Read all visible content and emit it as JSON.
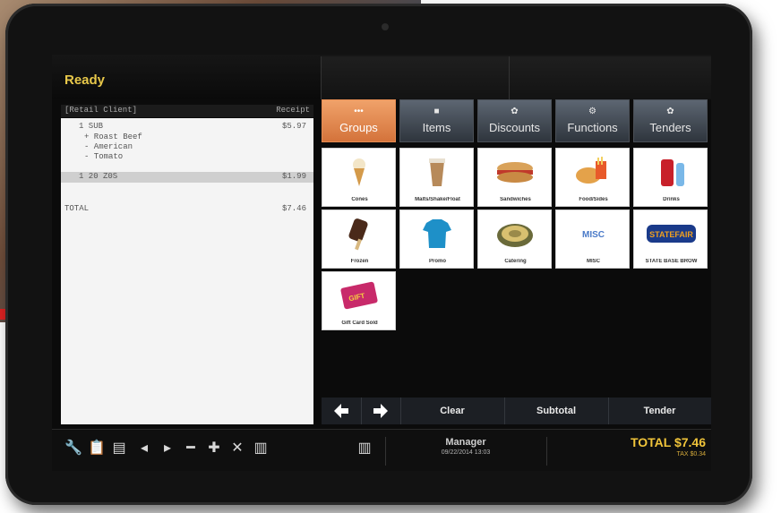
{
  "status": {
    "text": "Ready"
  },
  "receipt": {
    "header_left": "[Retail Client]",
    "header_right": "Receipt",
    "lines": [
      {
        "left": "1  SUB",
        "right": "$5.97"
      },
      {
        "left": "   + Roast Beef",
        "right": ""
      },
      {
        "left": "   - American",
        "right": ""
      },
      {
        "left": "   - Tomato",
        "right": ""
      },
      {
        "left": "1  20 Z0S",
        "right": "$1.99"
      },
      {
        "left": "TOTAL",
        "right": "$7.46"
      }
    ]
  },
  "tabs": [
    {
      "label": "Groups",
      "icon": "dots-icon",
      "glyph": "•••"
    },
    {
      "label": "Items",
      "icon": "square-icon",
      "glyph": "■"
    },
    {
      "label": "Discounts",
      "icon": "gear-icon",
      "glyph": "✿"
    },
    {
      "label": "Functions",
      "icon": "cog-icon",
      "glyph": "⚙"
    },
    {
      "label": "Tenders",
      "icon": "coin-icon",
      "glyph": "✿"
    }
  ],
  "groups": [
    {
      "label": "Cones",
      "icon": "ice-cream-cone-icon"
    },
    {
      "label": "Malts/Shake/Float",
      "icon": "milkshake-icon"
    },
    {
      "label": "Sandwiches",
      "icon": "sandwich-icon"
    },
    {
      "label": "Food/Sides",
      "icon": "food-sides-icon"
    },
    {
      "label": "Drinks",
      "icon": "drinks-icon"
    },
    {
      "label": "Frozen",
      "icon": "ice-cream-bar-icon"
    },
    {
      "label": "Promo",
      "icon": "tshirt-icon"
    },
    {
      "label": "Catering",
      "icon": "catering-tray-icon"
    },
    {
      "label": "MISC",
      "icon": "misc-icon",
      "tile_text": "MISC"
    },
    {
      "label": "STATE BASE BROW",
      "icon": "state-fair-logo-icon",
      "tile_text": "STATEFAIR"
    },
    {
      "label": "Gift Card Sold",
      "icon": "gift-card-icon",
      "tile_text": "GIFT"
    }
  ],
  "actions": {
    "prev_icon": "arrow-left-icon",
    "next_icon": "arrow-right-icon",
    "clear": "Clear",
    "subtotal": "Subtotal",
    "tender": "Tender"
  },
  "toolbar": [
    {
      "name": "wrench-icon",
      "glyph": "🔧"
    },
    {
      "name": "clipboard-icon",
      "glyph": "📋"
    },
    {
      "name": "document-icon",
      "glyph": "▤"
    },
    {
      "name": "previous-icon",
      "glyph": "◂"
    },
    {
      "name": "next-icon",
      "glyph": "▸"
    },
    {
      "name": "minus-icon",
      "glyph": "━"
    },
    {
      "name": "plus-icon",
      "glyph": "✚"
    },
    {
      "name": "delete-icon",
      "glyph": "✕"
    },
    {
      "name": "notepad-icon",
      "glyph": "▥"
    },
    {
      "name": "barcode-icon",
      "glyph": "▥"
    }
  ],
  "footer": {
    "user": "Manager",
    "datetime": "09/22/2014 13:03",
    "total_label": "TOTAL $7.46",
    "tax_label": "TAX $0.34"
  },
  "colors": {
    "accent_orange": "#e3854b",
    "total_gold": "#f0c43a",
    "status_yellow": "#e8c84a"
  }
}
